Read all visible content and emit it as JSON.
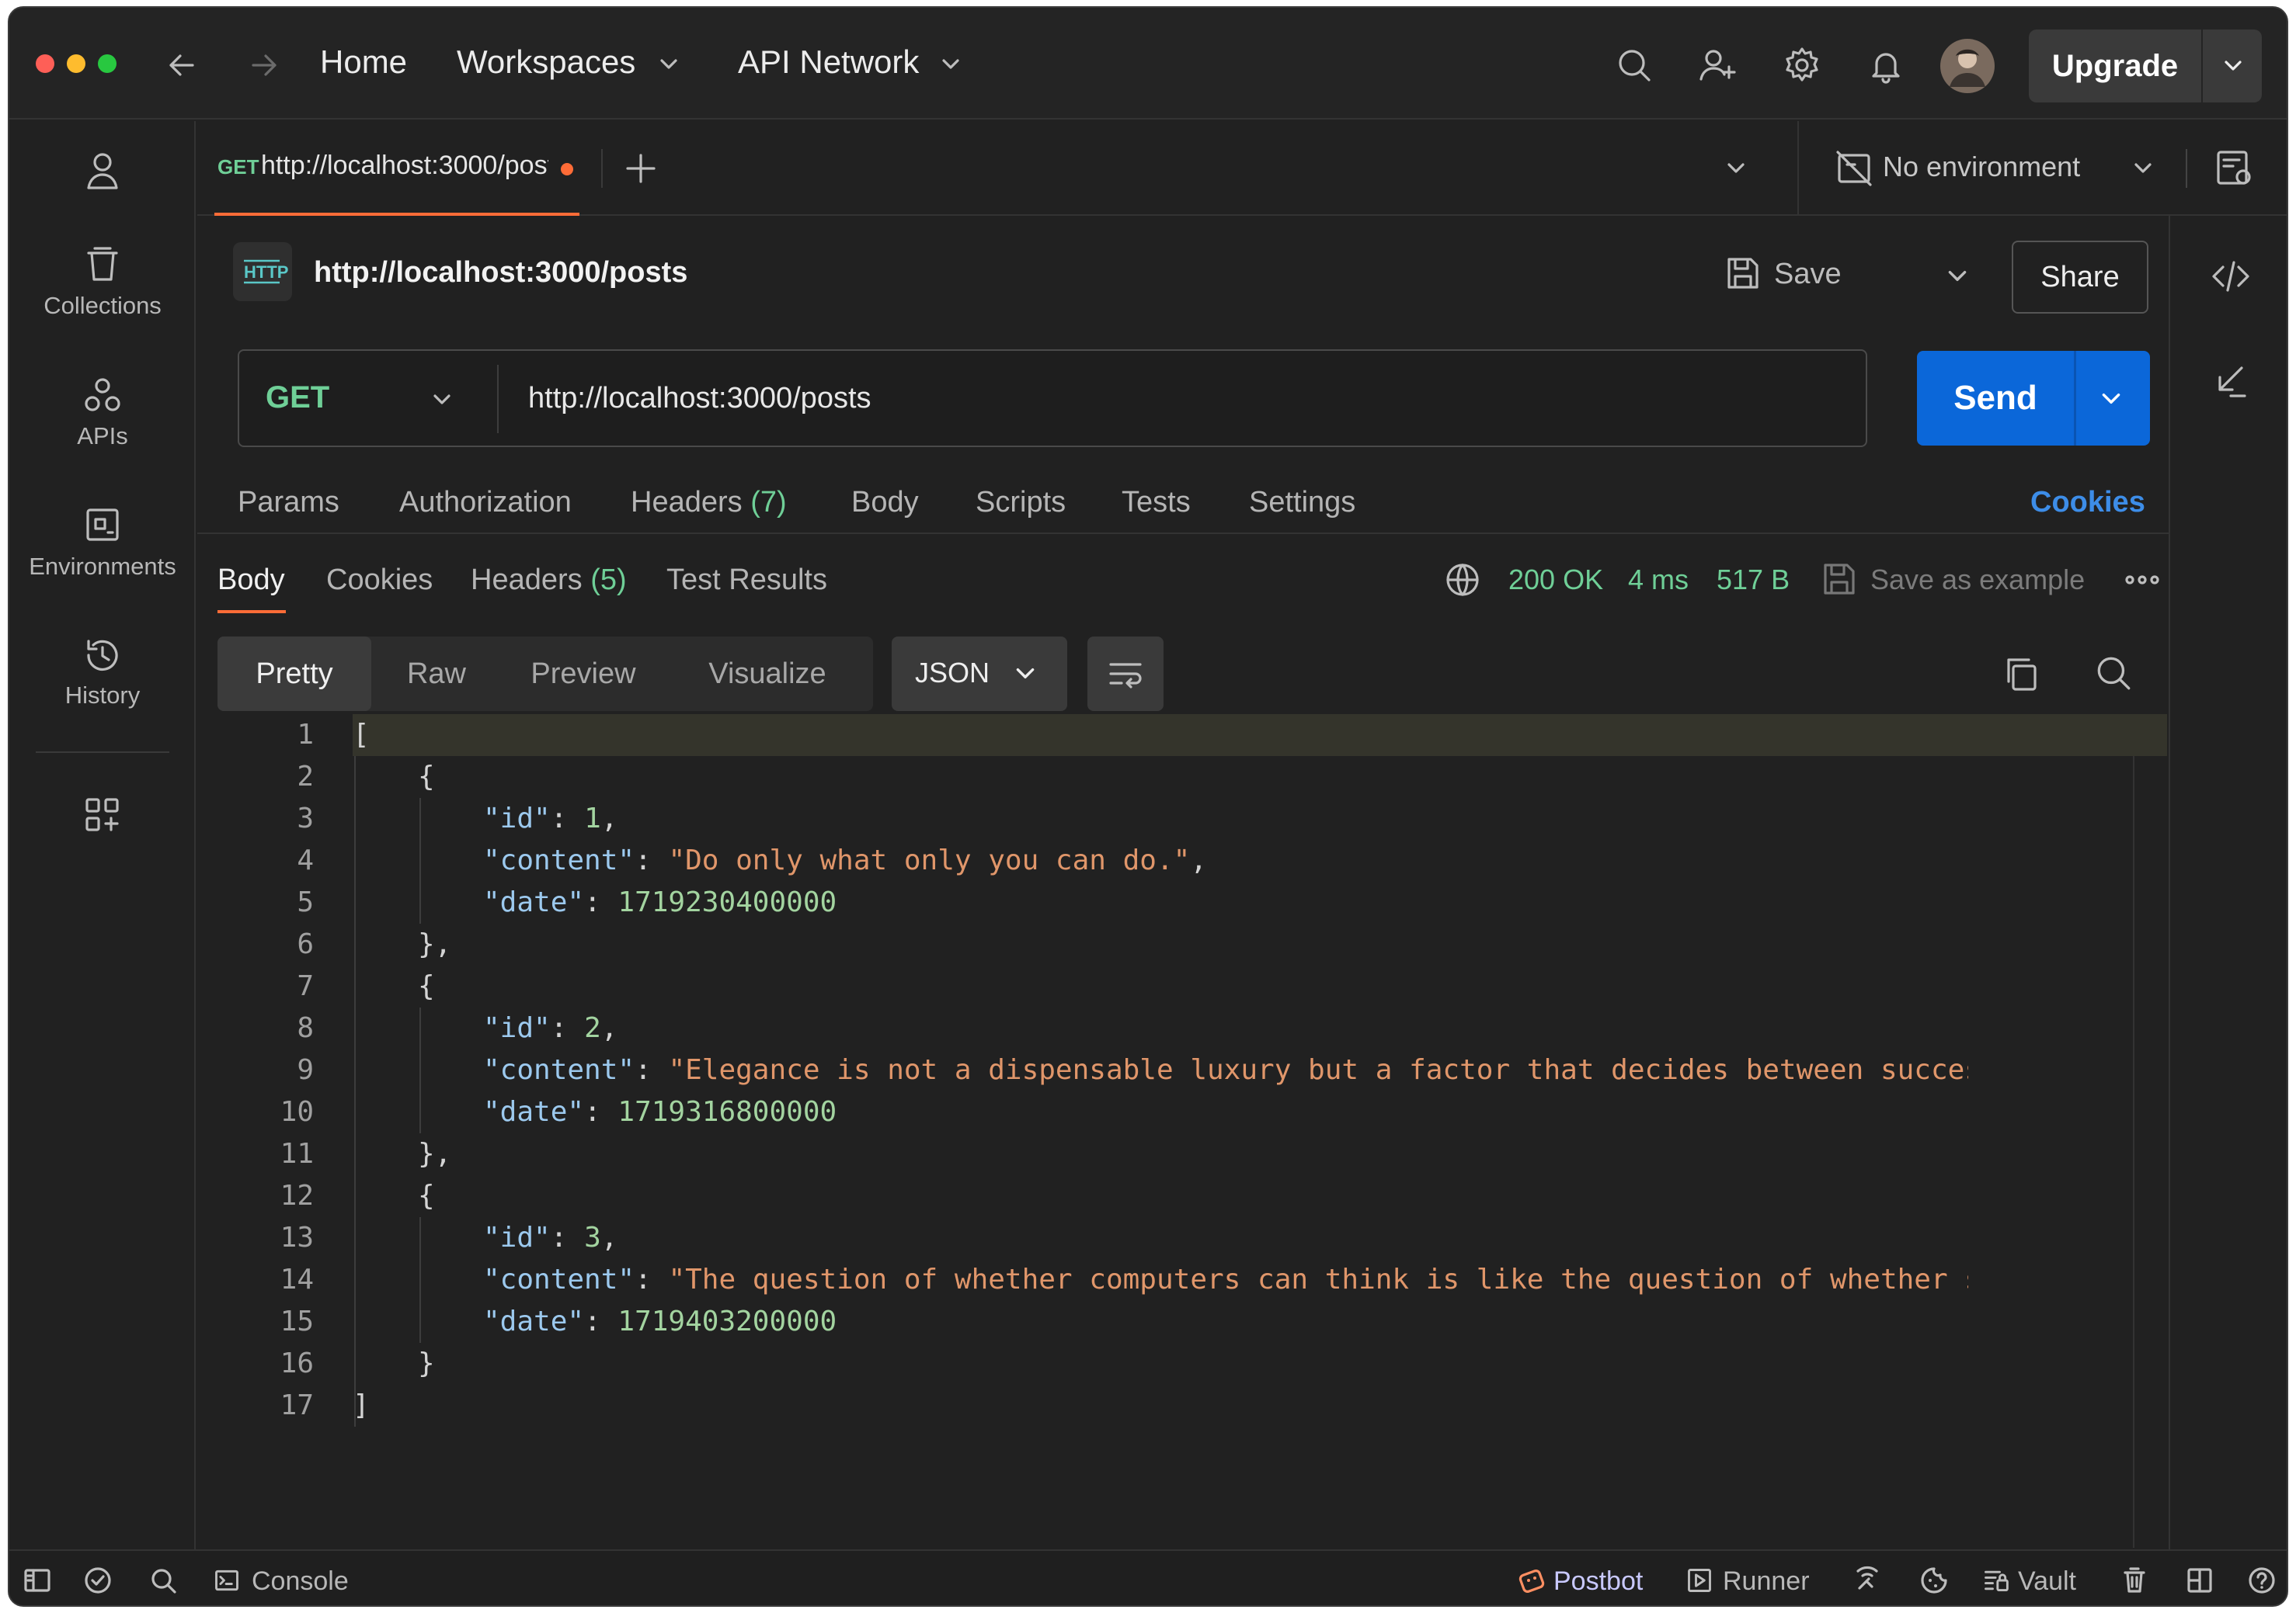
{
  "titlebar": {
    "home": "Home",
    "workspaces": "Workspaces",
    "api_network": "API Network",
    "upgrade": "Upgrade"
  },
  "sidebar": {
    "items": [
      {
        "label": "Collections"
      },
      {
        "label": "APIs"
      },
      {
        "label": "Environments"
      },
      {
        "label": "History"
      }
    ]
  },
  "tab": {
    "method": "GET",
    "url": "http://localhost:3000/posts"
  },
  "environment": {
    "label": "No environment"
  },
  "request": {
    "title": "http://localhost:3000/posts",
    "save_label": "Save",
    "share_label": "Share",
    "method": "GET",
    "url": "http://localhost:3000/posts",
    "send_label": "Send",
    "tabs": {
      "params": "Params",
      "authorization": "Authorization",
      "headers": "Headers",
      "headers_count": "(7)",
      "body": "Body",
      "scripts": "Scripts",
      "tests": "Tests",
      "settings": "Settings"
    },
    "cookies_link": "Cookies"
  },
  "response": {
    "tabs": {
      "body": "Body",
      "cookies": "Cookies",
      "headers": "Headers",
      "headers_count": "(5)",
      "test_results": "Test Results"
    },
    "status": "200 OK",
    "time": "4 ms",
    "size": "517 B",
    "save_example": "Save as example",
    "view_modes": [
      "Pretty",
      "Raw",
      "Preview",
      "Visualize"
    ],
    "active_view": "Pretty",
    "format": "JSON",
    "lines": [
      {
        "n": 1,
        "indent": 0,
        "parts": [
          [
            "pn",
            "["
          ]
        ]
      },
      {
        "n": 2,
        "indent": 1,
        "parts": [
          [
            "pn",
            "{"
          ]
        ]
      },
      {
        "n": 3,
        "indent": 2,
        "parts": [
          [
            "k",
            "\"id\""
          ],
          [
            "pn",
            ": "
          ],
          [
            "n",
            "1"
          ],
          [
            "pn",
            ","
          ]
        ]
      },
      {
        "n": 4,
        "indent": 2,
        "parts": [
          [
            "k",
            "\"content\""
          ],
          [
            "pn",
            ": "
          ],
          [
            "s",
            "\"Do only what only you can do.\""
          ],
          [
            "pn",
            ","
          ]
        ]
      },
      {
        "n": 5,
        "indent": 2,
        "parts": [
          [
            "k",
            "\"date\""
          ],
          [
            "pn",
            ": "
          ],
          [
            "n",
            "1719230400000"
          ]
        ]
      },
      {
        "n": 6,
        "indent": 1,
        "parts": [
          [
            "pn",
            "},"
          ]
        ]
      },
      {
        "n": 7,
        "indent": 1,
        "parts": [
          [
            "pn",
            "{"
          ]
        ]
      },
      {
        "n": 8,
        "indent": 2,
        "parts": [
          [
            "k",
            "\"id\""
          ],
          [
            "pn",
            ": "
          ],
          [
            "n",
            "2"
          ],
          [
            "pn",
            ","
          ]
        ]
      },
      {
        "n": 9,
        "indent": 2,
        "parts": [
          [
            "k",
            "\"content\""
          ],
          [
            "pn",
            ": "
          ],
          [
            "s",
            "\"Elegance is not a dispensable luxury but a factor that decides between success and failu"
          ]
        ]
      },
      {
        "n": 10,
        "indent": 2,
        "parts": [
          [
            "k",
            "\"date\""
          ],
          [
            "pn",
            ": "
          ],
          [
            "n",
            "1719316800000"
          ]
        ]
      },
      {
        "n": 11,
        "indent": 1,
        "parts": [
          [
            "pn",
            "},"
          ]
        ]
      },
      {
        "n": 12,
        "indent": 1,
        "parts": [
          [
            "pn",
            "{"
          ]
        ]
      },
      {
        "n": 13,
        "indent": 2,
        "parts": [
          [
            "k",
            "\"id\""
          ],
          [
            "pn",
            ": "
          ],
          [
            "n",
            "3"
          ],
          [
            "pn",
            ","
          ]
        ]
      },
      {
        "n": 14,
        "indent": 2,
        "parts": [
          [
            "k",
            "\"content\""
          ],
          [
            "pn",
            ": "
          ],
          [
            "s",
            "\"The question of whether computers can think is like the question of whether submarines c"
          ]
        ]
      },
      {
        "n": 15,
        "indent": 2,
        "parts": [
          [
            "k",
            "\"date\""
          ],
          [
            "pn",
            ": "
          ],
          [
            "n",
            "1719403200000"
          ]
        ]
      },
      {
        "n": 16,
        "indent": 1,
        "parts": [
          [
            "pn",
            "}"
          ]
        ]
      },
      {
        "n": 17,
        "indent": 0,
        "parts": [
          [
            "pn",
            "]"
          ]
        ]
      }
    ]
  },
  "statusbar": {
    "console": "Console",
    "postbot": "Postbot",
    "runner": "Runner",
    "vault": "Vault"
  },
  "colors": {
    "accent": "#ff6c37",
    "send": "#0b67d9",
    "success": "#6fcf97",
    "link": "#3d8de8"
  }
}
